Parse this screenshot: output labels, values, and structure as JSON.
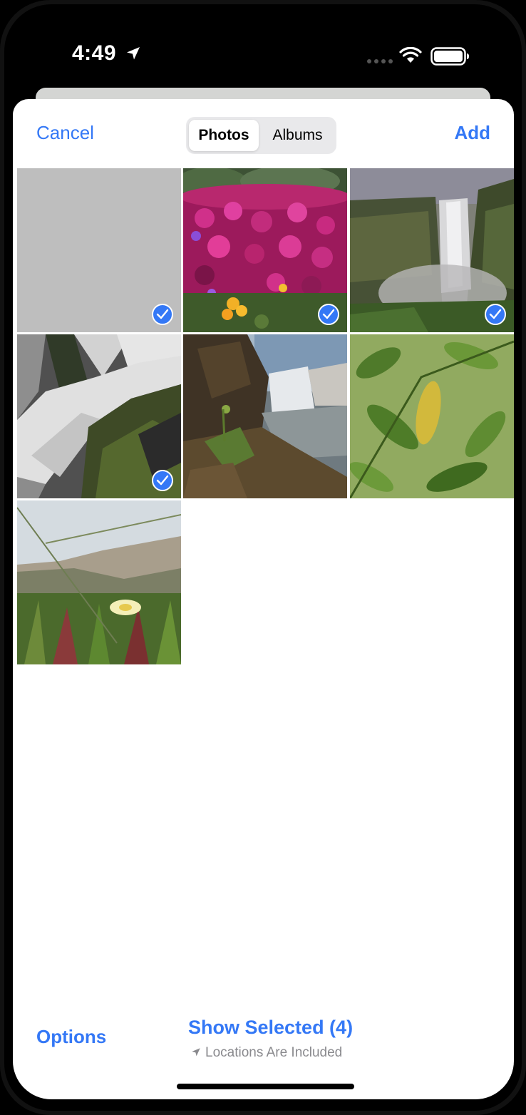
{
  "status_bar": {
    "time": "4:49",
    "icons": [
      "location-arrow-icon",
      "cellular-dots-icon",
      "wifi-icon",
      "battery-icon"
    ]
  },
  "nav": {
    "cancel_label": "Cancel",
    "add_label": "Add",
    "segments": [
      "Photos",
      "Albums"
    ],
    "selected_segment": "Photos"
  },
  "photos": [
    {
      "name": "blank-gray",
      "selected": true
    },
    {
      "name": "pink-flowers",
      "selected": true
    },
    {
      "name": "waterfall-cliff",
      "selected": true
    },
    {
      "name": "waterfall-rocks",
      "selected": true
    },
    {
      "name": "waterfall-shore",
      "selected": false
    },
    {
      "name": "green-leaves",
      "selected": false
    },
    {
      "name": "dune-flower",
      "selected": false
    }
  ],
  "bottom": {
    "options_label": "Options",
    "show_selected_label": "Show Selected (4)",
    "locations_label": "Locations Are Included"
  },
  "colors": {
    "accent": "#3478f6",
    "secondary_text": "#8a8a8e"
  }
}
